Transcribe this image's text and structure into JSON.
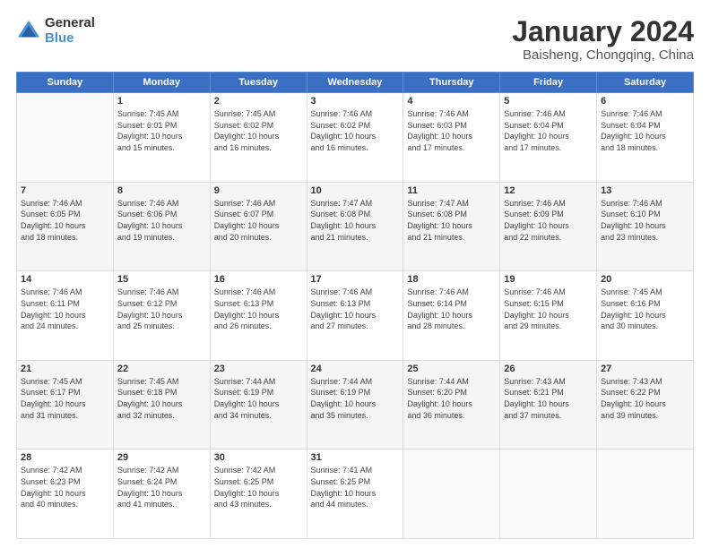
{
  "header": {
    "logo_general": "General",
    "logo_blue": "Blue",
    "month_title": "January 2024",
    "location": "Baisheng, Chongqing, China"
  },
  "days_of_week": [
    "Sunday",
    "Monday",
    "Tuesday",
    "Wednesday",
    "Thursday",
    "Friday",
    "Saturday"
  ],
  "weeks": [
    [
      {
        "day": "",
        "info": ""
      },
      {
        "day": "1",
        "info": "Sunrise: 7:45 AM\nSunset: 6:01 PM\nDaylight: 10 hours\nand 15 minutes."
      },
      {
        "day": "2",
        "info": "Sunrise: 7:45 AM\nSunset: 6:02 PM\nDaylight: 10 hours\nand 16 minutes."
      },
      {
        "day": "3",
        "info": "Sunrise: 7:46 AM\nSunset: 6:02 PM\nDaylight: 10 hours\nand 16 minutes."
      },
      {
        "day": "4",
        "info": "Sunrise: 7:46 AM\nSunset: 6:03 PM\nDaylight: 10 hours\nand 17 minutes."
      },
      {
        "day": "5",
        "info": "Sunrise: 7:46 AM\nSunset: 6:04 PM\nDaylight: 10 hours\nand 17 minutes."
      },
      {
        "day": "6",
        "info": "Sunrise: 7:46 AM\nSunset: 6:04 PM\nDaylight: 10 hours\nand 18 minutes."
      }
    ],
    [
      {
        "day": "7",
        "info": "Sunrise: 7:46 AM\nSunset: 6:05 PM\nDaylight: 10 hours\nand 18 minutes."
      },
      {
        "day": "8",
        "info": "Sunrise: 7:46 AM\nSunset: 6:06 PM\nDaylight: 10 hours\nand 19 minutes."
      },
      {
        "day": "9",
        "info": "Sunrise: 7:46 AM\nSunset: 6:07 PM\nDaylight: 10 hours\nand 20 minutes."
      },
      {
        "day": "10",
        "info": "Sunrise: 7:47 AM\nSunset: 6:08 PM\nDaylight: 10 hours\nand 21 minutes."
      },
      {
        "day": "11",
        "info": "Sunrise: 7:47 AM\nSunset: 6:08 PM\nDaylight: 10 hours\nand 21 minutes."
      },
      {
        "day": "12",
        "info": "Sunrise: 7:46 AM\nSunset: 6:09 PM\nDaylight: 10 hours\nand 22 minutes."
      },
      {
        "day": "13",
        "info": "Sunrise: 7:46 AM\nSunset: 6:10 PM\nDaylight: 10 hours\nand 23 minutes."
      }
    ],
    [
      {
        "day": "14",
        "info": "Sunrise: 7:46 AM\nSunset: 6:11 PM\nDaylight: 10 hours\nand 24 minutes."
      },
      {
        "day": "15",
        "info": "Sunrise: 7:46 AM\nSunset: 6:12 PM\nDaylight: 10 hours\nand 25 minutes."
      },
      {
        "day": "16",
        "info": "Sunrise: 7:46 AM\nSunset: 6:13 PM\nDaylight: 10 hours\nand 26 minutes."
      },
      {
        "day": "17",
        "info": "Sunrise: 7:46 AM\nSunset: 6:13 PM\nDaylight: 10 hours\nand 27 minutes."
      },
      {
        "day": "18",
        "info": "Sunrise: 7:46 AM\nSunset: 6:14 PM\nDaylight: 10 hours\nand 28 minutes."
      },
      {
        "day": "19",
        "info": "Sunrise: 7:46 AM\nSunset: 6:15 PM\nDaylight: 10 hours\nand 29 minutes."
      },
      {
        "day": "20",
        "info": "Sunrise: 7:45 AM\nSunset: 6:16 PM\nDaylight: 10 hours\nand 30 minutes."
      }
    ],
    [
      {
        "day": "21",
        "info": "Sunrise: 7:45 AM\nSunset: 6:17 PM\nDaylight: 10 hours\nand 31 minutes."
      },
      {
        "day": "22",
        "info": "Sunrise: 7:45 AM\nSunset: 6:18 PM\nDaylight: 10 hours\nand 32 minutes."
      },
      {
        "day": "23",
        "info": "Sunrise: 7:44 AM\nSunset: 6:19 PM\nDaylight: 10 hours\nand 34 minutes."
      },
      {
        "day": "24",
        "info": "Sunrise: 7:44 AM\nSunset: 6:19 PM\nDaylight: 10 hours\nand 35 minutes."
      },
      {
        "day": "25",
        "info": "Sunrise: 7:44 AM\nSunset: 6:20 PM\nDaylight: 10 hours\nand 36 minutes."
      },
      {
        "day": "26",
        "info": "Sunrise: 7:43 AM\nSunset: 6:21 PM\nDaylight: 10 hours\nand 37 minutes."
      },
      {
        "day": "27",
        "info": "Sunrise: 7:43 AM\nSunset: 6:22 PM\nDaylight: 10 hours\nand 39 minutes."
      }
    ],
    [
      {
        "day": "28",
        "info": "Sunrise: 7:42 AM\nSunset: 6:23 PM\nDaylight: 10 hours\nand 40 minutes."
      },
      {
        "day": "29",
        "info": "Sunrise: 7:42 AM\nSunset: 6:24 PM\nDaylight: 10 hours\nand 41 minutes."
      },
      {
        "day": "30",
        "info": "Sunrise: 7:42 AM\nSunset: 6:25 PM\nDaylight: 10 hours\nand 43 minutes."
      },
      {
        "day": "31",
        "info": "Sunrise: 7:41 AM\nSunset: 6:25 PM\nDaylight: 10 hours\nand 44 minutes."
      },
      {
        "day": "",
        "info": ""
      },
      {
        "day": "",
        "info": ""
      },
      {
        "day": "",
        "info": ""
      }
    ]
  ]
}
